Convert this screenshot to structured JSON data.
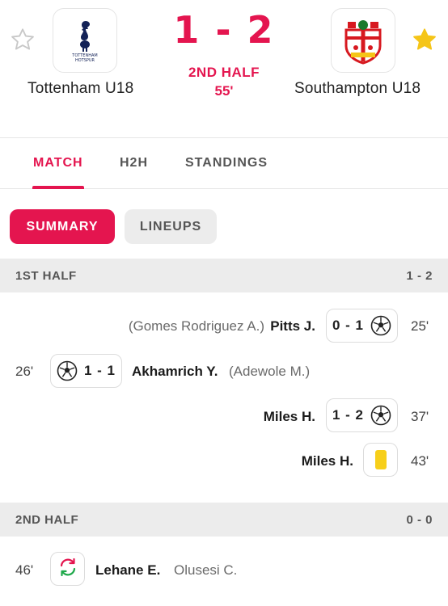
{
  "match": {
    "home_team": "Tottenham U18",
    "away_team": "Southampton U18",
    "score": "1 - 2",
    "status": "2ND HALF",
    "minute": "55'",
    "home_favorite": false,
    "away_favorite": true,
    "colors": {
      "accent": "#e4154f",
      "favorite_star": "#f5c518",
      "inactive_star": "#c8c8c8"
    }
  },
  "tabs": [
    {
      "label": "MATCH",
      "active": true
    },
    {
      "label": "H2H",
      "active": false
    },
    {
      "label": "STANDINGS",
      "active": false
    }
  ],
  "subtabs": [
    {
      "label": "SUMMARY",
      "active": true
    },
    {
      "label": "LINEUPS",
      "active": false
    }
  ],
  "sections": [
    {
      "title": "1ST HALF",
      "score": "1 - 2",
      "events": [
        {
          "side": "away",
          "type": "goal",
          "minute": "25'",
          "score": "0 - 1",
          "player": "Pitts J.",
          "assist": "(Gomes Rodriguez A.)",
          "icon": "football-icon"
        },
        {
          "side": "home",
          "type": "goal",
          "minute": "26'",
          "score": "1 - 1",
          "player": "Akhamrich Y.",
          "assist": "(Adewole M.)",
          "icon": "football-icon"
        },
        {
          "side": "away",
          "type": "goal",
          "minute": "37'",
          "score": "1 - 2",
          "player": "Miles H.",
          "icon": "football-icon"
        },
        {
          "side": "away",
          "type": "yellow-card",
          "minute": "43'",
          "player": "Miles H.",
          "icon": "yellow-card-icon"
        }
      ]
    },
    {
      "title": "2ND HALF",
      "score": "0 - 0",
      "events": [
        {
          "side": "home",
          "type": "substitution",
          "minute": "46'",
          "player": "Lehane E.",
          "player_out": "Olusesi C.",
          "icon": "substitution-icon"
        }
      ]
    }
  ]
}
